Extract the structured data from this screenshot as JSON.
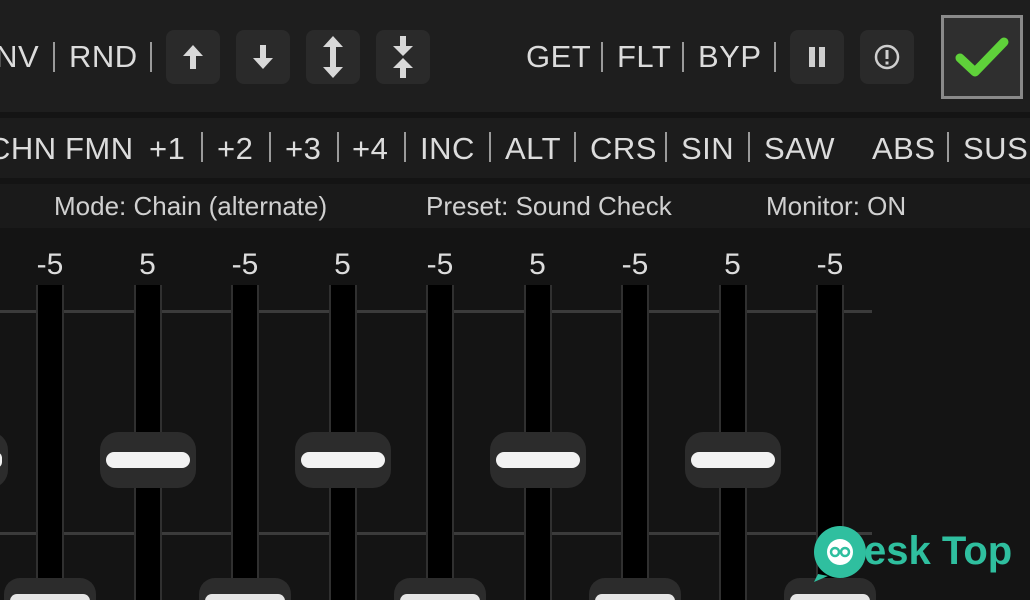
{
  "toolbar": {
    "inv_label": "INV",
    "rnd_label": "RND",
    "get_label": "GET",
    "flt_label": "FLT",
    "byp_label": "BYP",
    "icons": [
      "arrow-up-icon",
      "arrow-down-icon",
      "expand-vertical-icon",
      "collapse-vertical-icon",
      "pause-icon",
      "info-circle-icon",
      "checkmark-icon"
    ]
  },
  "modes": {
    "chn": "CHN",
    "fmn": "FMN",
    "p1": "+1",
    "p2": "+2",
    "p3": "+3",
    "p4": "+4",
    "inc": "INC",
    "alt": "ALT",
    "crs": "CRS",
    "sin": "SIN",
    "saw": "SAW",
    "abs": "ABS",
    "sus": "SUS"
  },
  "status": {
    "mode": "Mode: Chain (alternate)",
    "preset": "Preset: Sound Check",
    "monitor": "Monitor: ON"
  },
  "faders": [
    {
      "value": "-5"
    },
    {
      "value": "5"
    },
    {
      "value": "-5"
    },
    {
      "value": "5"
    },
    {
      "value": "-5"
    },
    {
      "value": "5"
    },
    {
      "value": "-5"
    },
    {
      "value": "5"
    },
    {
      "value": "-5"
    }
  ],
  "watermark": {
    "text": "esk Top"
  },
  "colors": {
    "accent_check": "#5fd13a",
    "background": "#141414",
    "watermark": "#2fbf9f"
  }
}
